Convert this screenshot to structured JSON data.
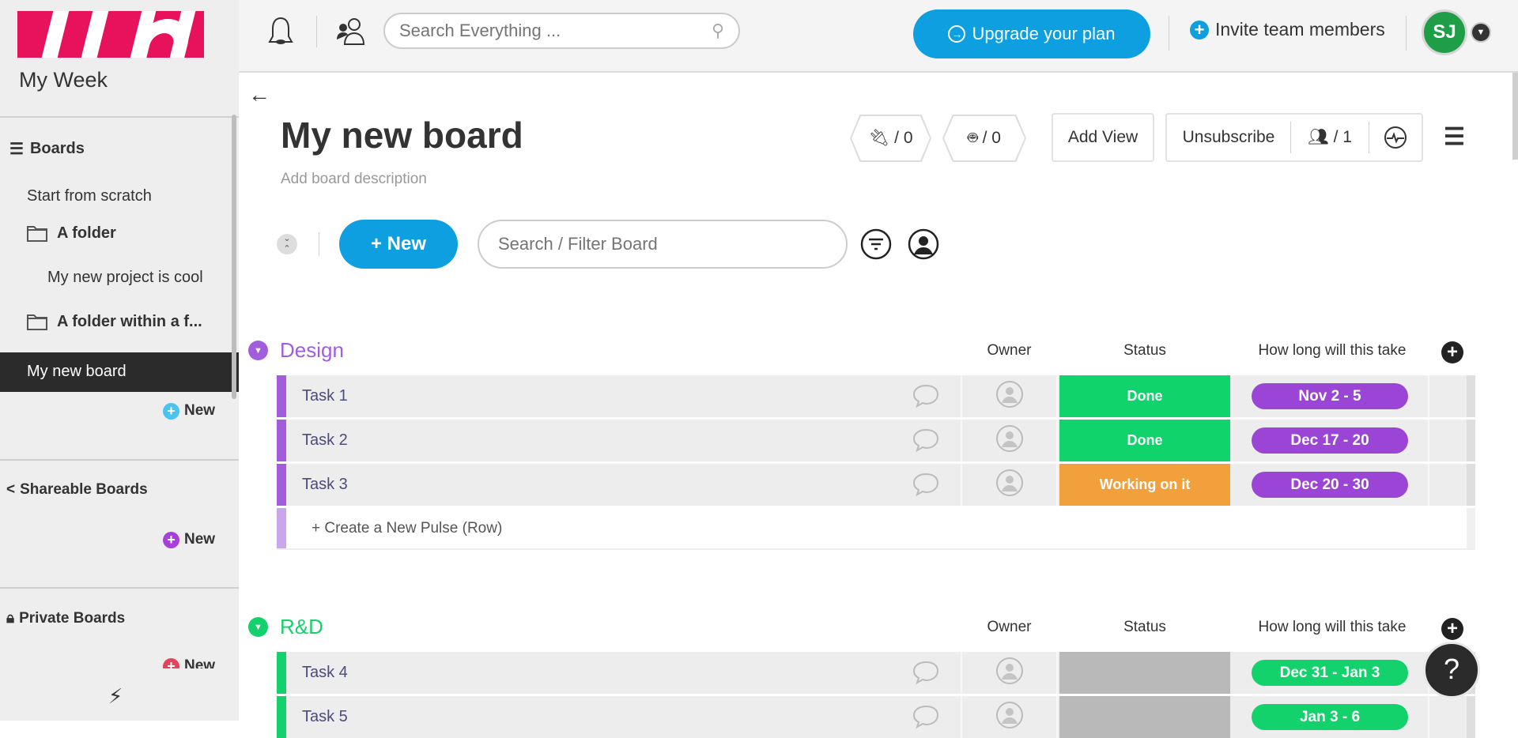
{
  "sidebar": {
    "title": "My Week",
    "boards_label": "Boards",
    "items": [
      {
        "label": "Start from scratch"
      },
      {
        "label": "A folder"
      },
      {
        "label": "My new project is cool"
      },
      {
        "label": "A folder within a f..."
      },
      {
        "label": "My new board"
      }
    ],
    "new_label": "New",
    "shareable_label": "Shareable Boards",
    "private_label": "Private Boards",
    "colors": {
      "main_new": "#4cc3ef",
      "shareable_new": "#a83fd9",
      "private_new": "#e2445c"
    }
  },
  "topbar": {
    "search_placeholder": "Search Everything ...",
    "upgrade_label": "Upgrade your plan",
    "invite_label": "Invite team members",
    "avatar_initials": "SJ"
  },
  "board": {
    "title": "My new board",
    "description": "Add board description",
    "integrations_count": "/ 0",
    "automations_count": "/ 0",
    "add_view_label": "Add View",
    "unsubscribe_label": "Unsubscribe",
    "members_count": "/ 1",
    "new_button_label": "+ New",
    "search_placeholder": "Search / Filter Board"
  },
  "columns": {
    "owner": "Owner",
    "status": "Status",
    "timeline": "How long will this take"
  },
  "groups": [
    {
      "title": "Design",
      "color": "#a25ddc",
      "rows": [
        {
          "name": "Task 1",
          "status": "Done",
          "status_color": "#11d36c",
          "timeline": "Nov 2 - 5"
        },
        {
          "name": "Task 2",
          "status": "Done",
          "status_color": "#11d36c",
          "timeline": "Dec 17 - 20"
        },
        {
          "name": "Task 3",
          "status": "Working on it",
          "status_color": "#f2a03b",
          "timeline": "Dec 20 - 30"
        }
      ],
      "timeline_color": "#9b45d6",
      "create_label": "+ Create a New Pulse (Row)"
    },
    {
      "title": "R&D",
      "color": "#13d26b",
      "rows": [
        {
          "name": "Task 4",
          "status": "",
          "status_color": "#b9b9b9",
          "timeline": "Dec 31 - Jan 3"
        },
        {
          "name": "Task 5",
          "status": "",
          "status_color": "#b9b9b9",
          "timeline": "Jan 3 - 6"
        }
      ],
      "timeline_color": "#13d26b"
    }
  ],
  "help_label": "?"
}
